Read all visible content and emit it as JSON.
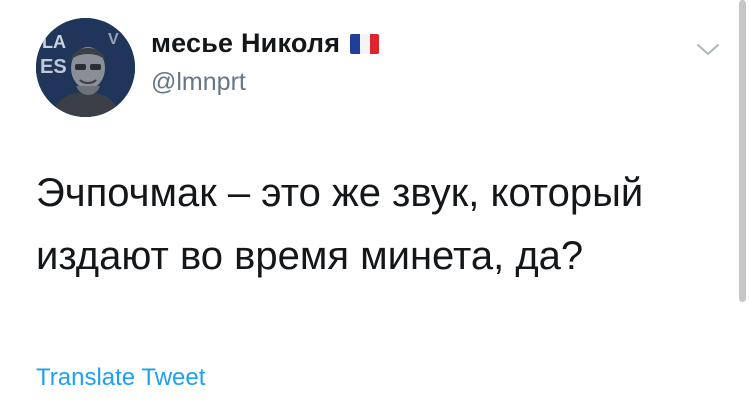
{
  "author": {
    "display_name": "месье Николя",
    "handle": "@lmnprt",
    "flag_icon": "france-flag-icon",
    "flag_colors": [
      "#1f3f9c",
      "#f4f4f4",
      "#e0242c"
    ]
  },
  "tweet": {
    "text": "Эчпочмак – это же звук, который\nиздают во время минета, да?"
  },
  "actions": {
    "translate_label": "Translate Tweet",
    "menu_icon": "chevron-down-icon"
  },
  "colors": {
    "link": "#1da1f2",
    "secondary_text": "#657786",
    "primary_text": "#14171a"
  }
}
